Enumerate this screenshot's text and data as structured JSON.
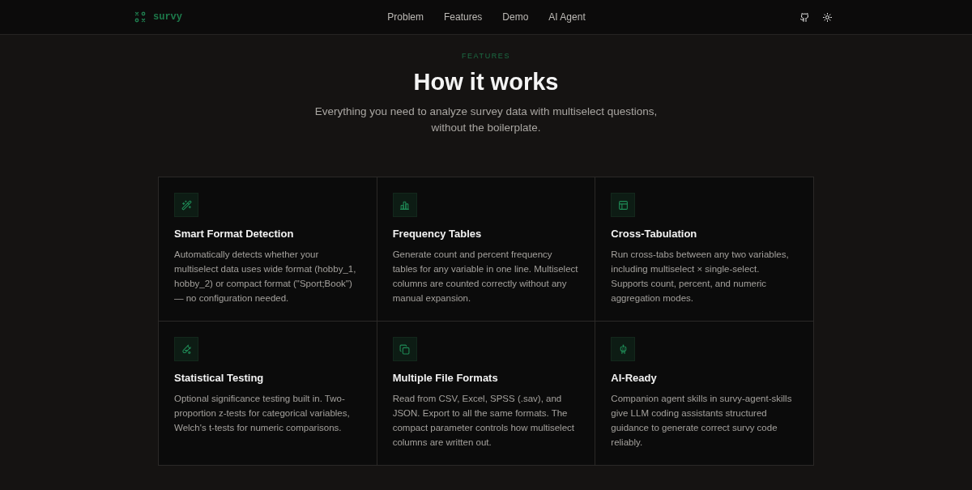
{
  "header": {
    "brand": "survy",
    "links": [
      "Problem",
      "Features",
      "Demo",
      "AI Agent"
    ]
  },
  "section": {
    "eyebrow": "FEATURES",
    "title": "How it works",
    "subtitle": "Everything you need to analyze survey data with multiselect questions, without the boilerplate."
  },
  "features": [
    {
      "title": "Smart Format Detection",
      "description": "Automatically detects whether your multiselect data uses wide format (hobby_1, hobby_2) or compact format (\"Sport;Book\") — no configuration needed."
    },
    {
      "title": "Frequency Tables",
      "description": "Generate count and percent frequency tables for any variable in one line. Multiselect columns are counted correctly without any manual expansion."
    },
    {
      "title": "Cross-Tabulation",
      "description": "Run cross-tabs between any two variables, including multiselect × single-select. Supports count, percent, and numeric aggregation modes."
    },
    {
      "title": "Statistical Testing",
      "description": "Optional significance testing built in. Two-proportion z-tests for categorical variables, Welch's t-tests for numeric comparisons."
    },
    {
      "title": "Multiple File Formats",
      "description": "Read from CSV, Excel, SPSS (.sav), and JSON. Export to all the same formats. The compact parameter controls how multiselect columns are written out."
    },
    {
      "title": "AI-Ready",
      "description": "Companion agent skills in survy-agent-skills give LLM coding assistants structured guidance to generate correct survy code reliably."
    }
  ]
}
